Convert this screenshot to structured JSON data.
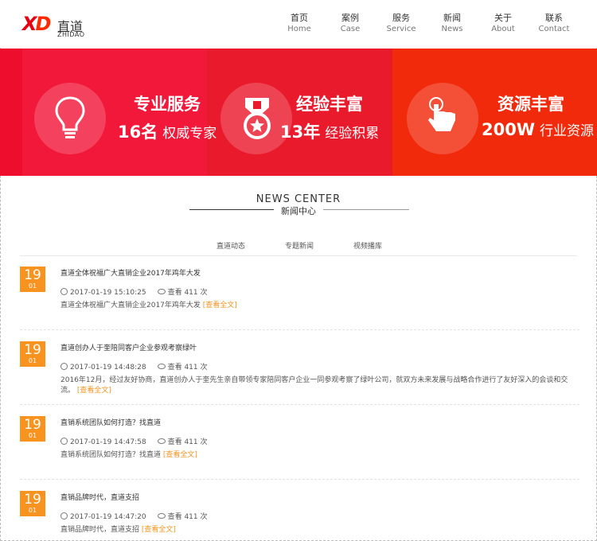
{
  "brand": {
    "cn": "直道",
    "en": "ZHIDAO"
  },
  "nav": [
    {
      "cn": "首页",
      "en": "Home"
    },
    {
      "cn": "案例",
      "en": "Case"
    },
    {
      "cn": "服务",
      "en": "Service"
    },
    {
      "cn": "新闻",
      "en": "News"
    },
    {
      "cn": "关于",
      "en": "About"
    },
    {
      "cn": "联系",
      "en": "Contact"
    }
  ],
  "banner": [
    {
      "icon": "lightbulb-icon",
      "title": "专业服务",
      "num": "16名",
      "text": "权威专家"
    },
    {
      "icon": "medal-icon",
      "title": "经验丰富",
      "num": "13年",
      "text": "经验积累"
    },
    {
      "icon": "hand-pointer-icon",
      "title": "资源丰富",
      "num": "200W",
      "text": "行业资源"
    }
  ],
  "news_center": {
    "en": "NEWS CENTER",
    "cn": "新闻中心"
  },
  "tabs": [
    "直道动态",
    "专题新闻",
    "视频播库"
  ],
  "news": [
    {
      "day": "19",
      "month": "01",
      "title": "直道全体祝福广大直销企业2017年鸡年大发",
      "time": "2017-01-19 15:10:25",
      "views": "查看 411 次",
      "desc": "直道全体祝福广大直销企业2017年鸡年大发",
      "more": "[查看全文]"
    },
    {
      "day": "19",
      "month": "01",
      "title": "直道创办人于奎陪同客户企业参观考察绿叶",
      "time": "2017-01-19 14:48:28",
      "views": "查看 411 次",
      "desc": "2016年12月，经过友好协商，直道创办人于奎先生亲自带领专家陪同客户企业一同参观考察了绿叶公司，就双方未来发展与战略合作进行了友好深入的会谈和交流。",
      "more": "[查看全文]"
    },
    {
      "day": "19",
      "month": "01",
      "title": "直销系统团队如何打造？找直道",
      "time": "2017-01-19 14:47:58",
      "views": "查看 411 次",
      "desc": "直销系统团队如何打造？找直道",
      "more": "[查看全文]"
    },
    {
      "day": "19",
      "month": "01",
      "title": "直销品牌时代，直道支招",
      "time": "2017-01-19 14:47:20",
      "views": "查看 411 次",
      "desc": "直销品牌时代，直道支招",
      "more": "[查看全文]"
    }
  ]
}
